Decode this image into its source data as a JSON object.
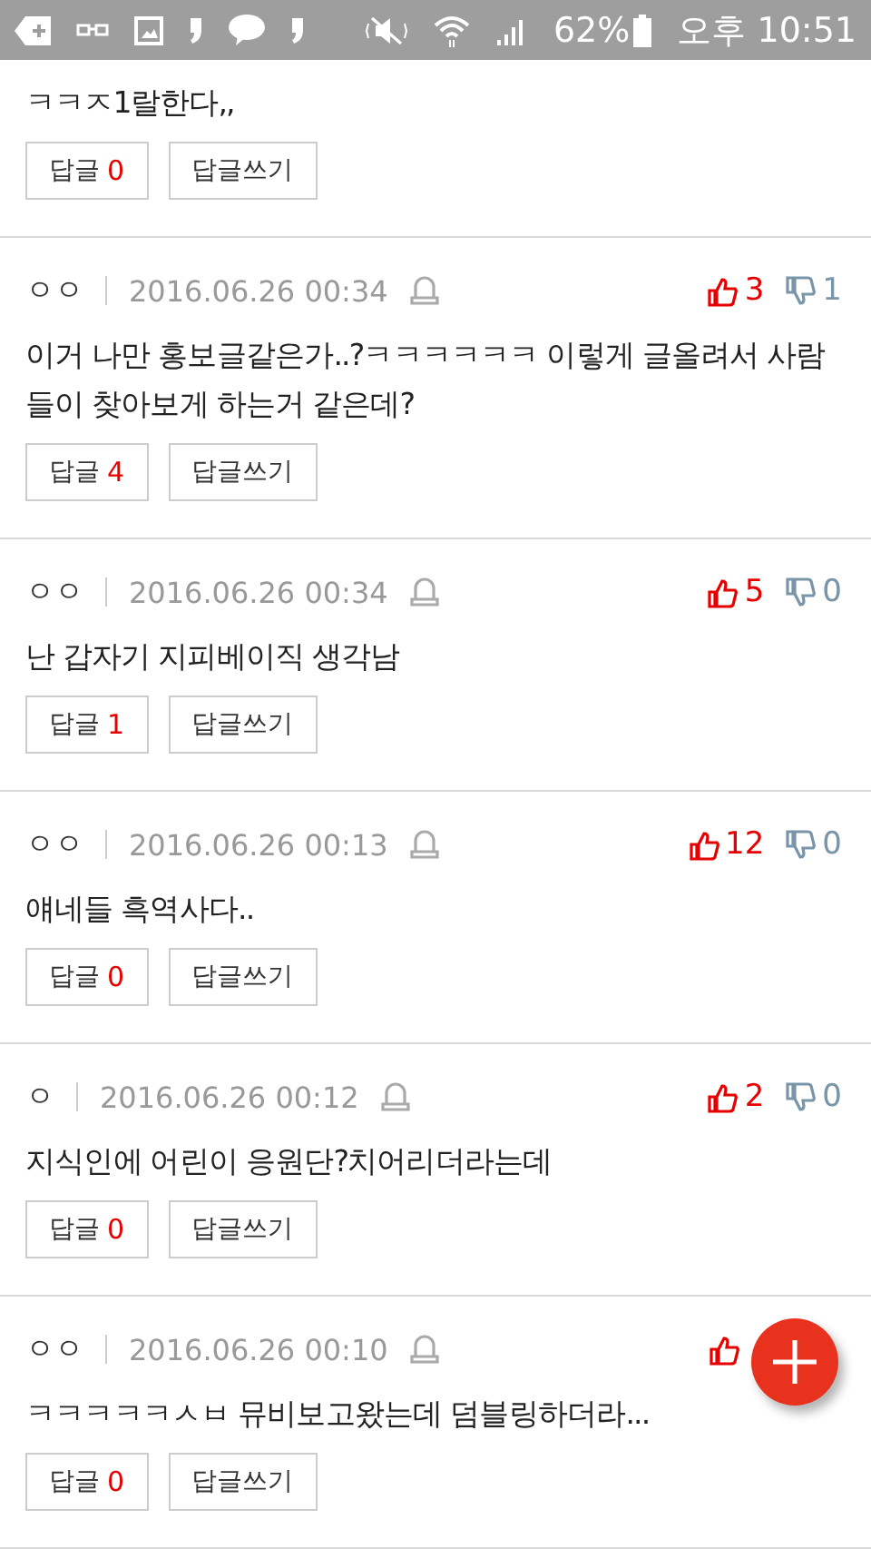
{
  "status_bar": {
    "battery": "62%",
    "time": "오후 10:51"
  },
  "comments": [
    {
      "body": "ㅋㅋㅈ1랄한다,,",
      "reply_label": "답글",
      "replies": "0",
      "write_label": "답글쓰기"
    },
    {
      "author": "ㅇㅇ",
      "date": "2016.06.26 00:34",
      "likes": "3",
      "dislikes": "1",
      "body": "이거 나만 홍보글같은가..?ㅋㅋㅋㅋㅋㅋ 이렇게 글올려서 사람들이 찾아보게 하는거 같은데?",
      "reply_label": "답글",
      "replies": "4",
      "write_label": "답글쓰기"
    },
    {
      "author": "ㅇㅇ",
      "date": "2016.06.26 00:34",
      "likes": "5",
      "dislikes": "0",
      "body": "난 갑자기 지피베이직 생각남",
      "reply_label": "답글",
      "replies": "1",
      "write_label": "답글쓰기"
    },
    {
      "author": "ㅇㅇ",
      "date": "2016.06.26 00:13",
      "likes": "12",
      "dislikes": "0",
      "body": "얘네들 흑역사다..",
      "reply_label": "답글",
      "replies": "0",
      "write_label": "답글쓰기"
    },
    {
      "author": "ㅇ",
      "date": "2016.06.26 00:12",
      "likes": "2",
      "dislikes": "0",
      "body": "지식인에 어린이 응원단?치어리더라는데",
      "reply_label": "답글",
      "replies": "0",
      "write_label": "답글쓰기"
    },
    {
      "author": "ㅇㅇ",
      "date": "2016.06.26 00:10",
      "body": "ㅋㅋㅋㅋㅋㅅㅂ 뮤비보고왔는데 덤블링하더라...",
      "reply_label": "답글",
      "replies": "0",
      "write_label": "답글쓰기"
    }
  ]
}
